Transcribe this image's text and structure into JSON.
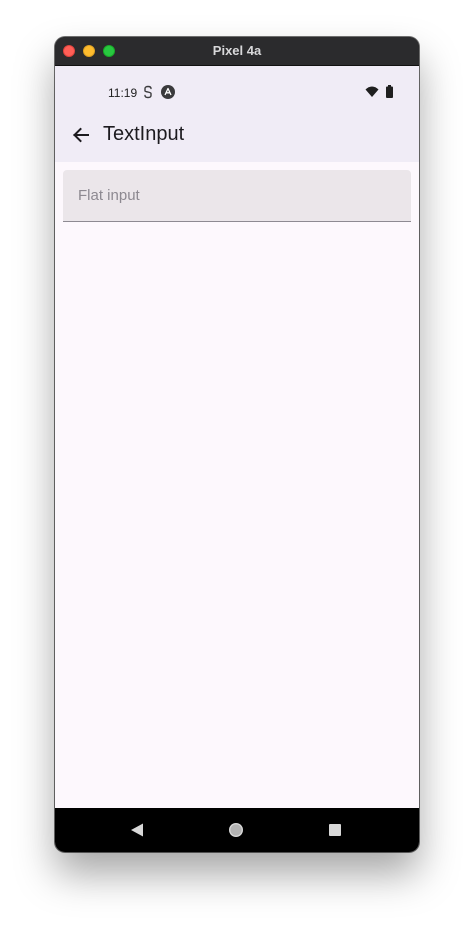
{
  "window": {
    "title": "Pixel 4a"
  },
  "status_bar": {
    "time": "11:19",
    "icons": [
      "s-notification-icon",
      "a-notification-icon",
      "wifi-icon",
      "battery-icon"
    ]
  },
  "app_bar": {
    "title": "TextInput",
    "back_icon": "arrow-back-icon"
  },
  "text_input": {
    "placeholder": "Flat input",
    "value": ""
  },
  "nav_bar": {
    "icons": [
      "nav-back-icon",
      "nav-home-icon",
      "nav-recents-icon"
    ]
  },
  "colors": {
    "app_bar_bg": "#f0ecf6",
    "screen_bg": "#fdf8fd",
    "input_bg": "#ebe6ea",
    "placeholder": "#8d8991",
    "close": "#ff5f57",
    "minimize": "#febc2e",
    "maximize": "#28c840"
  }
}
